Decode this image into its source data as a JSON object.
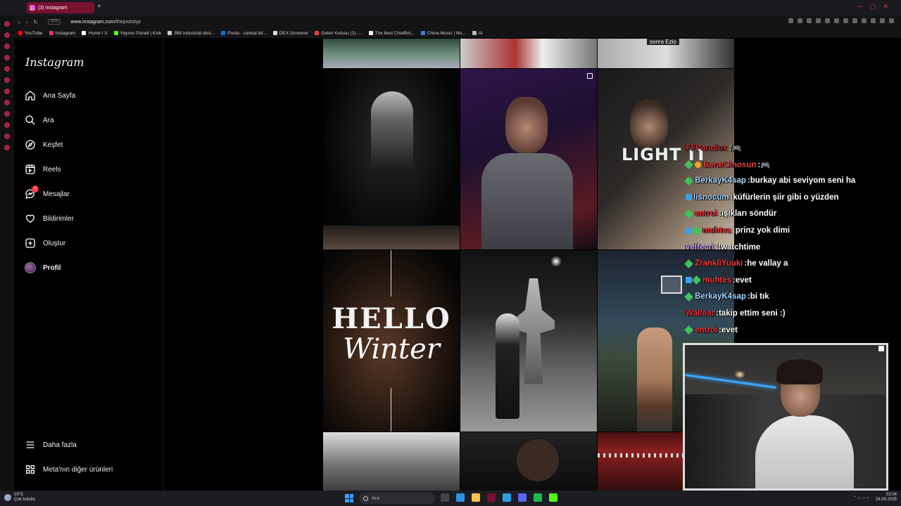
{
  "browser": {
    "tab_title": "(3) Instagram",
    "new_tab": "+",
    "vpn_label": "VPN",
    "url_host": "www.instagram.com",
    "url_path": "/theprototyp",
    "bookmarks": [
      {
        "label": "YouTube",
        "color": "#ff0000"
      },
      {
        "label": "Instagram",
        "color": "#e1306c"
      },
      {
        "label": "Home / X",
        "color": "#ffffff"
      },
      {
        "label": "Yayıncı Paneli | Kick",
        "color": "#53fc18"
      },
      {
        "label": "388 Industrial desi...",
        "color": "#cccccc"
      },
      {
        "label": "Posta - cankat bil...",
        "color": "#0078d4"
      },
      {
        "label": "DEX Screener",
        "color": "#dddddd"
      },
      {
        "label": "Gelen Kutusu (2) -...",
        "color": "#ea4335"
      },
      {
        "label": "The best ChatBot...",
        "color": "#ffffff"
      },
      {
        "label": "China Music | No...",
        "color": "#3a7bd5"
      },
      {
        "label": "AI",
        "color": "#bbbbbb"
      }
    ]
  },
  "nav": {
    "logo": "Instagram",
    "items": [
      {
        "label": "Ana Sayfa",
        "icon": "home-icon"
      },
      {
        "label": "Ara",
        "icon": "search-icon"
      },
      {
        "label": "Keşfet",
        "icon": "compass-icon"
      },
      {
        "label": "Reels",
        "icon": "reels-icon"
      },
      {
        "label": "Mesajlar",
        "icon": "messenger-icon",
        "badge": "3"
      },
      {
        "label": "Bildirimler",
        "icon": "heart-icon"
      },
      {
        "label": "Oluştur",
        "icon": "plus-square-icon"
      },
      {
        "label": "Profil",
        "icon": "avatar"
      }
    ],
    "more": "Daha fazla",
    "meta": "Meta'nın diğer ürünleri"
  },
  "posts": {
    "top_caption": "sonra Ezio",
    "light_title": "LIGHT IT",
    "hello_title": "HELLO",
    "winter_title": "Winter"
  },
  "chat": [
    {
      "user": "FFParadox",
      "msg": "🎮",
      "user_color": "#c0303a",
      "badge": "none"
    },
    {
      "user": "BeratCinosun",
      "msg": "🎮",
      "user_color": "#e84040",
      "badge": "gem-coin"
    },
    {
      "user": "BerkayK4sap",
      "msg": "burkay abi seviyom seni ha",
      "user_color": "#a8d8ff",
      "badge": "gem"
    },
    {
      "user": "lisnocum",
      "msg": "küfürlerin şiir gibi o yüzden",
      "user_color": "#a8d8ff",
      "badge": "square"
    },
    {
      "user": "entroi",
      "msg": "ışıkları söndür",
      "user_color": "#ff3a3a",
      "badge": "gem"
    },
    {
      "user": "muhtes",
      "msg": "prinz yok dimi",
      "user_color": "#ff3a3a",
      "badge": "square-gem"
    },
    {
      "user": "velfecri",
      "msg": "!watchtime",
      "user_color": "#d0a8ff",
      "badge": "none"
    },
    {
      "user": "ZrankliYuuki",
      "msg": "he vallay a",
      "user_color": "#ff3a3a",
      "badge": "gem"
    },
    {
      "user": "muhtes",
      "msg": "evet",
      "user_color": "#ff3a3a",
      "badge": "square-gem"
    },
    {
      "user": "BerkayK4sap",
      "msg": "bi tık",
      "user_color": "#a8d8ff",
      "badge": "gem"
    },
    {
      "user": "Waltear",
      "msg": "takip ettim seni :)",
      "user_color": "#e83040",
      "badge": "none"
    },
    {
      "user": "entroi",
      "msg": "evet",
      "user_color": "#ff3a3a",
      "badge": "gem"
    }
  ],
  "taskbar": {
    "temperature": "19°C",
    "weather": "Çok bulutlu",
    "search_placeholder": "Ara",
    "time": "02:04",
    "date": "24.09.2025"
  }
}
